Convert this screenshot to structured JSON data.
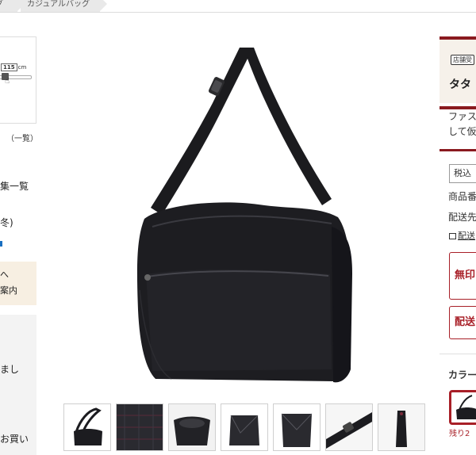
{
  "breadcrumb": {
    "items": [
      "グ",
      "カジュアルバッグ"
    ]
  },
  "left_panel": {
    "size_value": "115",
    "size_unit": "cm",
    "list_link": "（一覧）",
    "nav_items": [
      "集一覧",
      "冬)"
    ],
    "info_box_lines": [
      "へ",
      "案内"
    ],
    "sub_lines": [
      "まし",
      "お買い"
    ]
  },
  "product": {
    "thumbnail_count": 7
  },
  "right_panel": {
    "badge": "店舗受",
    "title": "タタ",
    "note_lines": [
      "ファス",
      "して仮"
    ],
    "tax_label": "税込",
    "product_code_label": "商品番",
    "delivery_label": "配送先",
    "delivery_link": "配送",
    "button_primary": "無印",
    "button_secondary": "配送",
    "color_label": "カラー",
    "stock_text": "残り2"
  },
  "colors": {
    "accent": "#8a1a1f",
    "button_border": "#a81f27",
    "info_bg": "#f7efe2"
  }
}
